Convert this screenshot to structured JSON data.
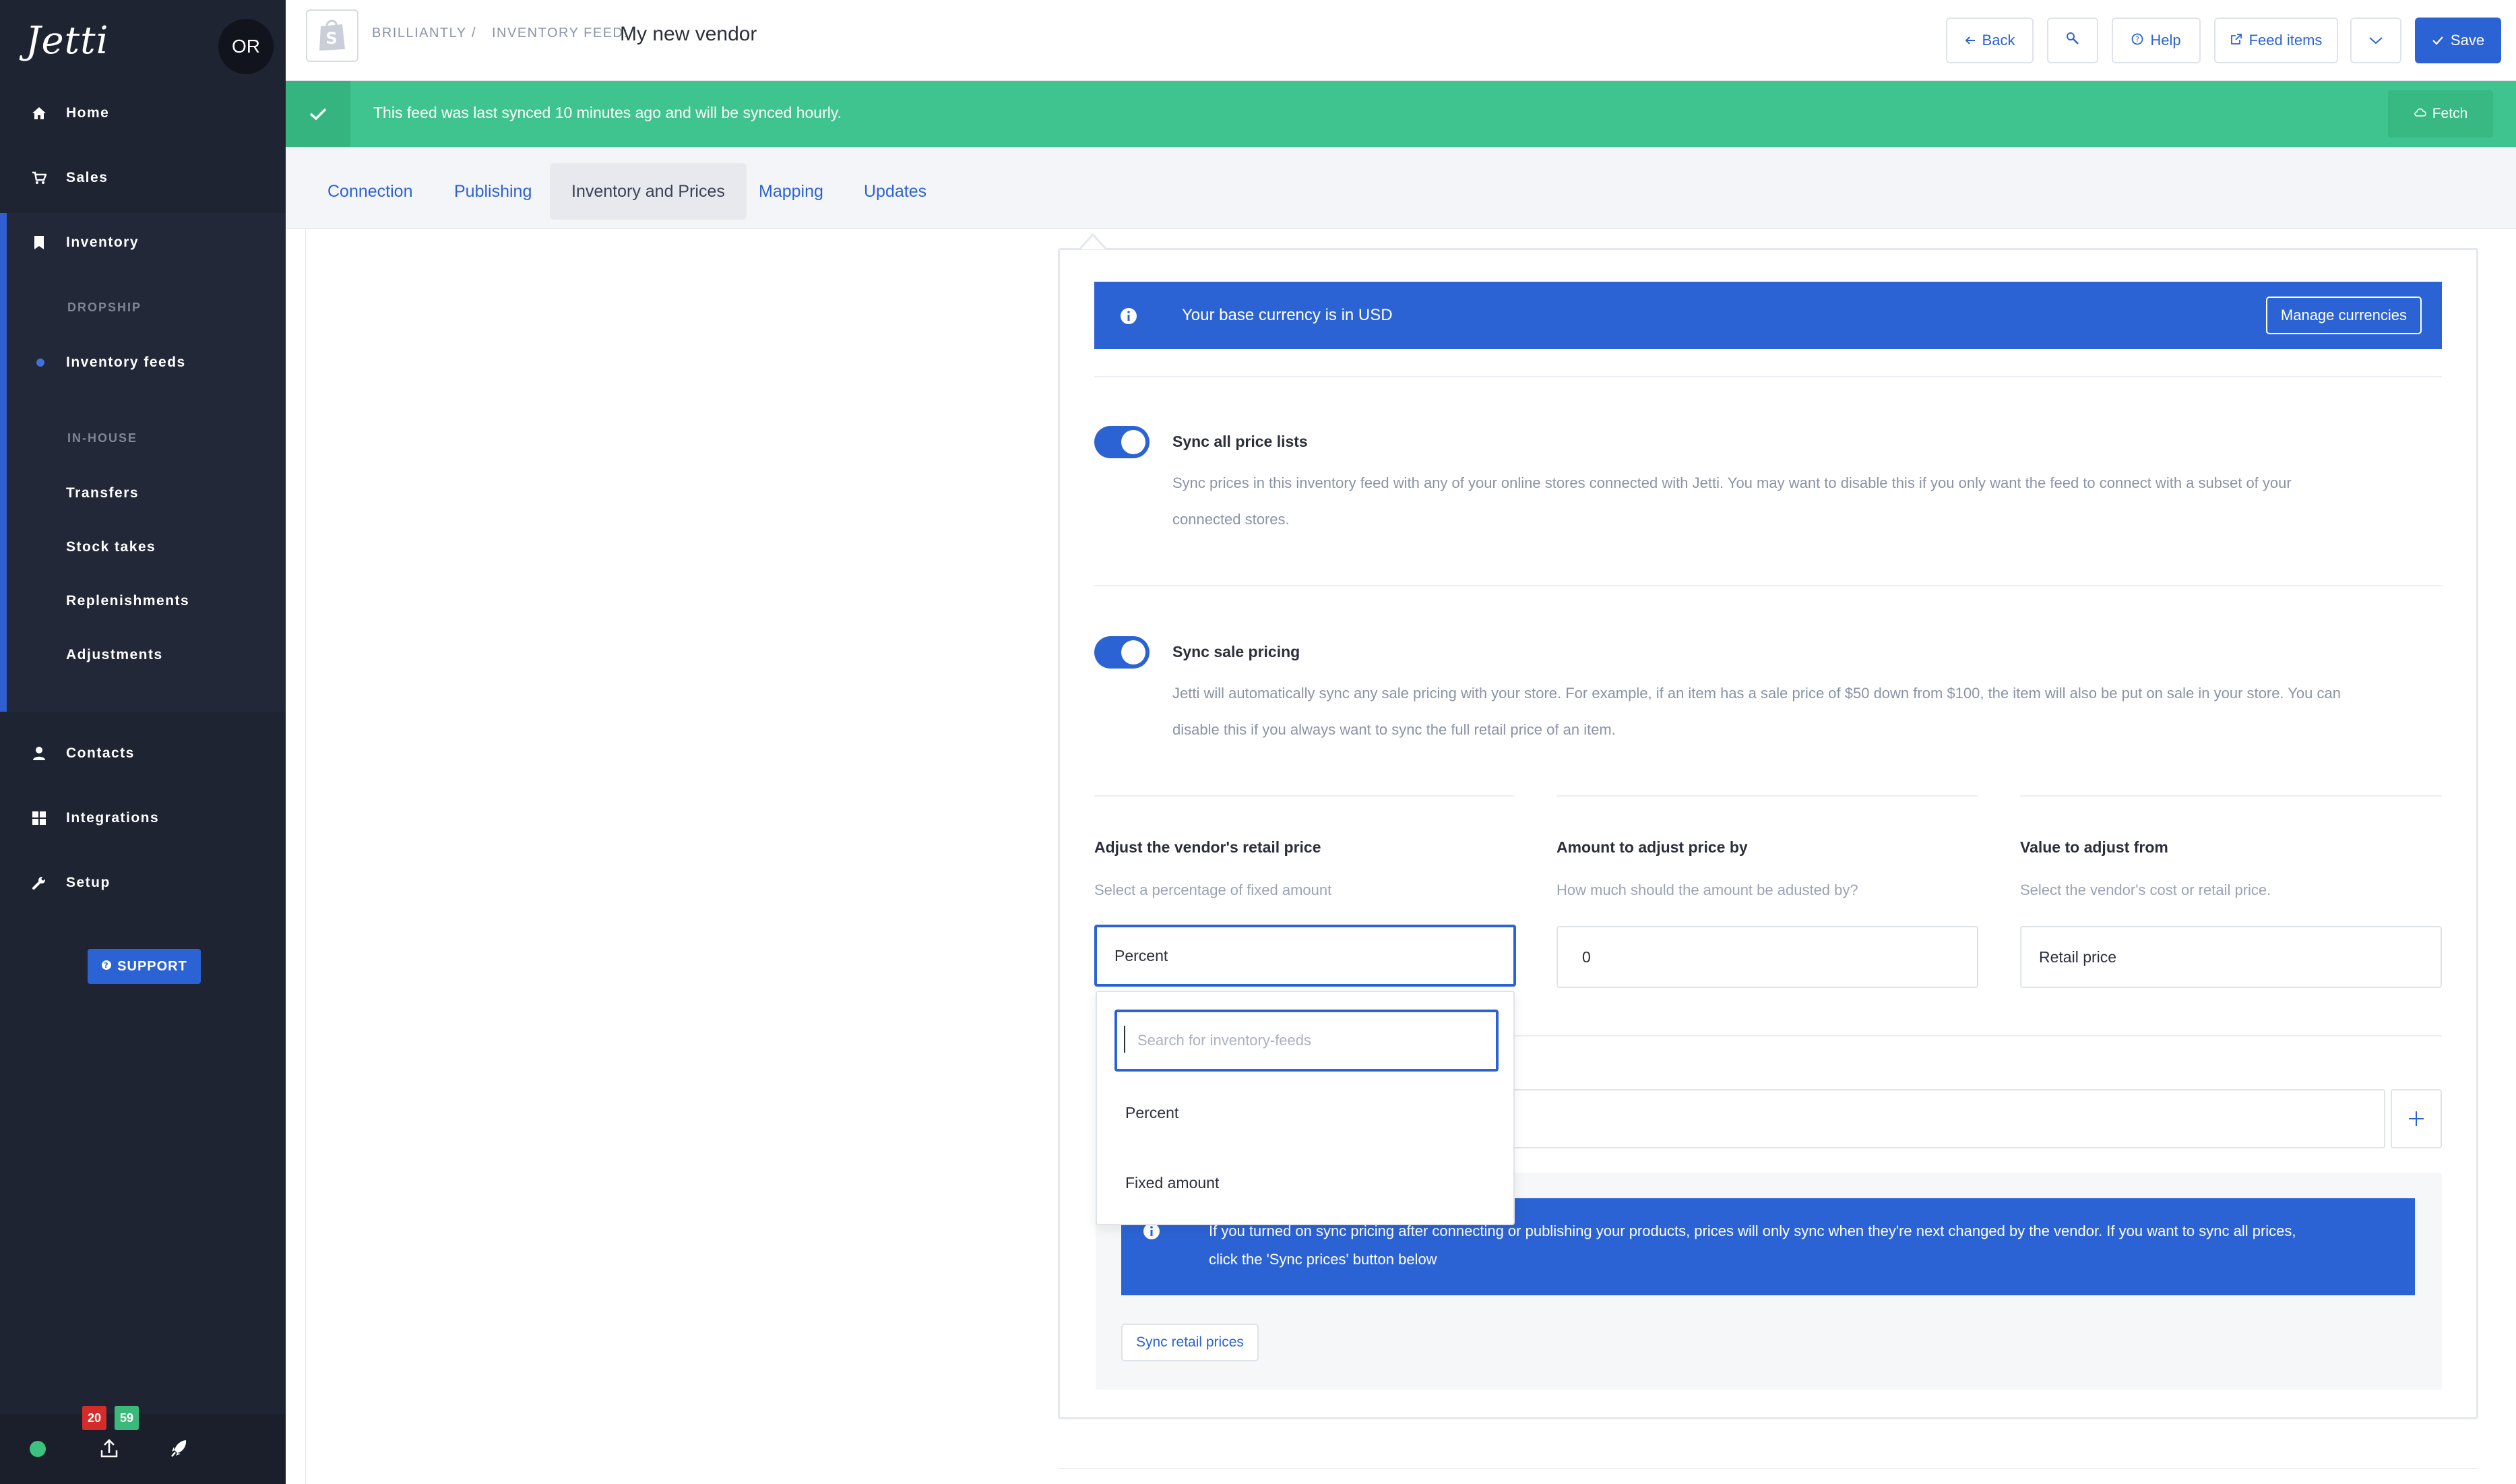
{
  "app": {
    "logo_text": "Jetti",
    "user_initials": "OR"
  },
  "sidebar": {
    "items": [
      {
        "label": "Home",
        "icon": "home-icon"
      },
      {
        "label": "Sales",
        "icon": "cart-icon"
      },
      {
        "label": "Inventory",
        "icon": "bookmark-icon"
      },
      {
        "label": "Contacts",
        "icon": "person-icon"
      },
      {
        "label": "Integrations",
        "icon": "grid-icon"
      },
      {
        "label": "Setup",
        "icon": "wrench-icon"
      }
    ],
    "sections": {
      "dropship": "DROPSHIP",
      "inhouse": "IN-HOUSE"
    },
    "sub_items": [
      "Inventory feeds",
      "Transfers",
      "Stock takes",
      "Replenishments",
      "Adjustments"
    ],
    "support_label": "SUPPORT",
    "badges": {
      "red": "20",
      "green": "59"
    }
  },
  "header": {
    "breadcrumb_store": "BRILLIANTLY",
    "breadcrumb_sep": "/",
    "breadcrumb_prefix": "INVENTORY FEED:",
    "title": "My new vendor",
    "buttons": {
      "back": "Back",
      "help": "Help",
      "feed_items": "Feed items",
      "save": "Save"
    }
  },
  "sync_banner": {
    "message": "This feed was last synced 10 minutes ago and will be synced hourly.",
    "fetch_label": "Fetch"
  },
  "tabs": [
    {
      "label": "Connection"
    },
    {
      "label": "Publishing"
    },
    {
      "label": "Inventory and Prices",
      "active": true
    },
    {
      "label": "Mapping"
    },
    {
      "label": "Updates"
    }
  ],
  "currency_banner": {
    "message": "Your base currency is in USD",
    "button": "Manage currencies"
  },
  "settings": {
    "sync_price_lists": {
      "title": "Sync all price lists",
      "desc_line1": "Sync prices in this inventory feed with any of your online stores connected with Jetti. You may want to disable this if you only want the feed to connect with a subset of your",
      "desc_line2": "connected stores.",
      "enabled": true
    },
    "sync_sale_pricing": {
      "title": "Sync sale pricing",
      "desc_line1": "Jetti will automatically sync any sale pricing with your store. For example, if an item has a sale price of $50 down from $100, the item will also be put on sale in your store. You can",
      "desc_line2": "disable this if you always want to sync the full retail price of an item.",
      "enabled": true
    }
  },
  "adjust": {
    "retail_label": "Adjust the vendor's retail price",
    "retail_help": "Select a percentage of fixed amount",
    "retail_value": "Percent",
    "amount_label": "Amount to adjust price by",
    "amount_help": "How much should the amount be adusted by?",
    "amount_value": "0",
    "from_label": "Value to adjust from",
    "from_help": "Select the vendor's cost or retail price.",
    "from_value": "Retail price"
  },
  "dropdown": {
    "search_placeholder": "Search for inventory-feeds",
    "options": [
      "Percent",
      "Fixed amount"
    ]
  },
  "sync_notice": {
    "line1": "If you turned on sync pricing after connecting or publishing your products, prices will only sync when they're next changed by the vendor. If you want to sync all prices,",
    "line2": "click the 'Sync prices' button below",
    "button": "Sync retail prices"
  },
  "colors": {
    "sidebar": "#1f2433",
    "accent": "#2c63d4",
    "success": "#40c48f",
    "badge_red": "#d42b2b",
    "badge_green": "#3cb87b"
  }
}
